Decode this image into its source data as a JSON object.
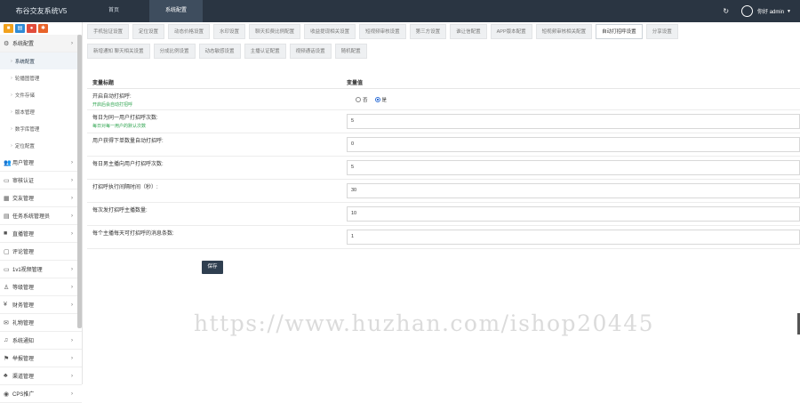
{
  "app": {
    "title": "布谷交友系统V5"
  },
  "topnav": [
    {
      "label": "首页",
      "active": false
    },
    {
      "label": "系统配置",
      "active": true
    }
  ],
  "user": {
    "refresh_icon": "refresh-icon",
    "name": "你好 admin"
  },
  "sidebar": {
    "sections": [
      {
        "label": "系统配置",
        "icon": "gears-icon",
        "open": true,
        "items": [
          {
            "label": "系统配置",
            "active": true
          },
          {
            "label": "轮播图管理",
            "active": false
          },
          {
            "label": "文件存储",
            "active": false
          },
          {
            "label": "版本管理",
            "active": false
          },
          {
            "label": "数字库管理",
            "active": false
          },
          {
            "label": "定位配置",
            "active": false
          }
        ]
      },
      {
        "label": "用户管理",
        "icon": "users-icon"
      },
      {
        "label": "审核认证",
        "icon": "id-card-icon"
      },
      {
        "label": "交友管理",
        "icon": "heart-icon"
      },
      {
        "label": "任务系统管理员",
        "icon": "tasks-icon"
      },
      {
        "label": "直播管理",
        "icon": "video-icon"
      },
      {
        "label": "评论管理",
        "icon": "comment-icon"
      },
      {
        "label": "1v1视频管理",
        "icon": "camera-icon"
      },
      {
        "label": "等级管理",
        "icon": "level-icon"
      },
      {
        "label": "财务管理",
        "icon": "yen-icon"
      },
      {
        "label": "礼物管理",
        "icon": "gift-icon"
      },
      {
        "label": "系统通知",
        "icon": "bell-icon"
      },
      {
        "label": "举报管理",
        "icon": "flag-icon"
      },
      {
        "label": "渠道管理",
        "icon": "channel-icon"
      },
      {
        "label": "CPS推广",
        "icon": "eye-icon"
      }
    ]
  },
  "tabs": {
    "row1": [
      {
        "label": "手机验证设置",
        "active": false
      },
      {
        "label": "定位设置",
        "active": false
      },
      {
        "label": "动态价格设置",
        "active": false
      },
      {
        "label": "水印设置",
        "active": false
      },
      {
        "label": "聊天扣费比例配置",
        "active": false
      },
      {
        "label": "收益提现相关设置",
        "active": false
      },
      {
        "label": "短视频审核设置",
        "active": false
      },
      {
        "label": "第三方设置",
        "active": false
      },
      {
        "label": "谁让信配置",
        "active": false
      },
      {
        "label": "APP版本配置",
        "active": false
      },
      {
        "label": "短视频审核相关配置",
        "active": false
      },
      {
        "label": "自动打招呼设置",
        "active": true
      },
      {
        "label": "分享设置",
        "active": false
      }
    ],
    "row2": [
      {
        "label": "新增通知 聊天相关设置",
        "active": false
      },
      {
        "label": "分成比例设置",
        "active": false
      },
      {
        "label": "动态敏感设置",
        "active": false
      },
      {
        "label": "主播认证配置",
        "active": false
      },
      {
        "label": "视频通话设置",
        "active": false
      },
      {
        "label": "随机配置",
        "active": false
      }
    ]
  },
  "form": {
    "header": {
      "name": "变量标题",
      "value": "变量值"
    },
    "rows": [
      {
        "label": "开启自动打招呼:",
        "hint": "开启后会自动打招呼",
        "type": "radio",
        "options": [
          {
            "label": "否",
            "checked": false
          },
          {
            "label": "是",
            "checked": true
          }
        ]
      },
      {
        "label": "每日为同一用户打招呼次数:",
        "hint": "每日对每一用户的默认次数",
        "type": "input",
        "value": "5"
      },
      {
        "label": "用户获得下单数量自动打招呼:",
        "hint": "",
        "type": "input",
        "value": "0"
      },
      {
        "label": "每日男主播向用户打招呼次数:",
        "hint": "",
        "type": "input",
        "value": "5"
      },
      {
        "label": "打招呼执行间隔时间（秒）:",
        "hint": "",
        "type": "input",
        "value": "30"
      },
      {
        "label": "每次发打招呼主播数量:",
        "hint": "",
        "type": "input",
        "value": "10"
      },
      {
        "label": "每个主播每天可打招呼的消息条数:",
        "hint": "",
        "type": "input",
        "value": "1"
      }
    ],
    "save_label": "保存"
  },
  "watermark": "https://www.huzhan.com/ishop20445"
}
